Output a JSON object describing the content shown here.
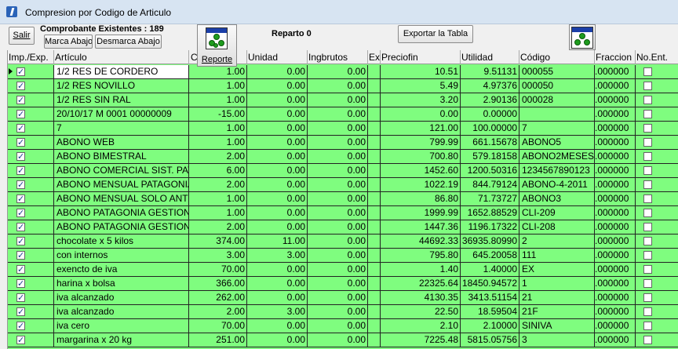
{
  "window": {
    "title": "Compresion por Codigo de Articulo"
  },
  "toolbar": {
    "salir_label": "Salir",
    "comprobantes": "Comprobante Existentes : 189",
    "marca_label": "Marca Abajo",
    "desmarca_label": "Desmarca Abajo",
    "reporte_label": "Reporte",
    "reparto": "Reparto 0",
    "exportar_label": "Exportar la Tabla"
  },
  "table": {
    "columns": [
      "Imp./Exp.",
      "Artículo",
      "C",
      "Unidad",
      "Ingbrutos",
      "Exe",
      "Preciofin",
      "Utilidad",
      "Código",
      "Fraccion",
      "No.Ent."
    ],
    "rows": [
      {
        "art": "1/2 RES DE CORDERO",
        "cant": "1.00",
        "unidad": "0.00",
        "ing": "0.00",
        "precio": "10.51",
        "util": "9.51131",
        "cod": "000055",
        "frac": ".000000"
      },
      {
        "art": "1/2 RES NOVILLO",
        "cant": "1.00",
        "unidad": "0.00",
        "ing": "0.00",
        "precio": "5.49",
        "util": "4.97376",
        "cod": "000050",
        "frac": ".000000"
      },
      {
        "art": "1/2 RES SIN RAL",
        "cant": "1.00",
        "unidad": "0.00",
        "ing": "0.00",
        "precio": "3.20",
        "util": "2.90136",
        "cod": "000028",
        "frac": ".000000"
      },
      {
        "art": "20/10/17 M 0001 00000009",
        "cant": "-15.00",
        "unidad": "0.00",
        "ing": "0.00",
        "precio": "0.00",
        "util": "0.00000",
        "cod": "",
        "frac": ".000000"
      },
      {
        "art": "7",
        "cant": "1.00",
        "unidad": "0.00",
        "ing": "0.00",
        "precio": "121.00",
        "util": "100.00000",
        "cod": "7",
        "frac": ".000000"
      },
      {
        "art": "ABONO  WEB",
        "cant": "1.00",
        "unidad": "0.00",
        "ing": "0.00",
        "precio": "799.99",
        "util": "661.15678",
        "cod": "ABONO5",
        "frac": ".000000"
      },
      {
        "art": "ABONO BIMESTRAL",
        "cant": "2.00",
        "unidad": "0.00",
        "ing": "0.00",
        "precio": "700.80",
        "util": "579.18158",
        "cod": "ABONO2MESES",
        "frac": ".000000"
      },
      {
        "art": "ABONO COMERCIAL SIST. PAT",
        "cant": "6.00",
        "unidad": "0.00",
        "ing": "0.00",
        "precio": "1452.60",
        "util": "1200.50316",
        "cod": "1234567890123",
        "frac": ".000000"
      },
      {
        "art": "ABONO MENSUAL PATAGONIA",
        "cant": "2.00",
        "unidad": "0.00",
        "ing": "0.00",
        "precio": "1022.19",
        "util": "844.79124",
        "cod": "ABONO-4-2011",
        "frac": ".000000"
      },
      {
        "art": "ABONO MENSUAL SOLO ANTI",
        "cant": "1.00",
        "unidad": "0.00",
        "ing": "0.00",
        "precio": "86.80",
        "util": "71.73727",
        "cod": "ABONO3",
        "frac": ".000000"
      },
      {
        "art": "ABONO PATAGONIA GESTION",
        "cant": "1.00",
        "unidad": "0.00",
        "ing": "0.00",
        "precio": "1999.99",
        "util": "1652.88529",
        "cod": "CLI-209",
        "frac": ".000000"
      },
      {
        "art": "ABONO PATAGONIA GESTION",
        "cant": "2.00",
        "unidad": "0.00",
        "ing": "0.00",
        "precio": "1447.36",
        "util": "1196.17322",
        "cod": "CLI-208",
        "frac": ".000000"
      },
      {
        "art": "chocolate x 5 kilos",
        "cant": "374.00",
        "unidad": "11.00",
        "ing": "0.00",
        "precio": "44692.33",
        "util": "36935.80990",
        "cod": "2",
        "frac": ".000000"
      },
      {
        "art": "con internos",
        "cant": "3.00",
        "unidad": "3.00",
        "ing": "0.00",
        "precio": "795.80",
        "util": "645.20058",
        "cod": "111",
        "frac": ".000000"
      },
      {
        "art": "exencto de iva",
        "cant": "70.00",
        "unidad": "0.00",
        "ing": "0.00",
        "precio": "1.40",
        "util": "1.40000",
        "cod": "EX",
        "frac": ".000000"
      },
      {
        "art": "harina x bolsa",
        "cant": "366.00",
        "unidad": "0.00",
        "ing": "0.00",
        "precio": "22325.64",
        "util": "18450.94572",
        "cod": "1",
        "frac": ".000000"
      },
      {
        "art": "iva alcanzado",
        "cant": "262.00",
        "unidad": "0.00",
        "ing": "0.00",
        "precio": "4130.35",
        "util": "3413.51154",
        "cod": "21",
        "frac": ".000000"
      },
      {
        "art": "iva alcanzado",
        "cant": "2.00",
        "unidad": "3.00",
        "ing": "0.00",
        "precio": "22.50",
        "util": "18.59504",
        "cod": "21F",
        "frac": ".000000"
      },
      {
        "art": "iva cero",
        "cant": "70.00",
        "unidad": "0.00",
        "ing": "0.00",
        "precio": "2.10",
        "util": "2.10000",
        "cod": "SINIVA",
        "frac": ".000000"
      },
      {
        "art": "margarina x 20 kg",
        "cant": "251.00",
        "unidad": "0.00",
        "ing": "0.00",
        "precio": "7225.48",
        "util": "5815.05756",
        "cod": "3",
        "frac": ".000000"
      }
    ]
  }
}
